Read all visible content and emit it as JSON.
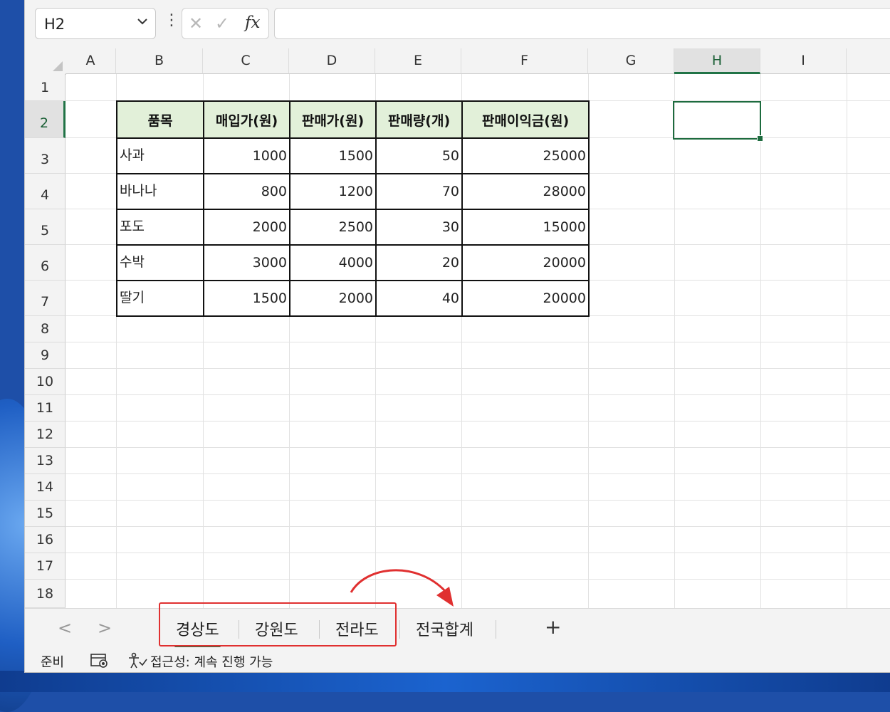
{
  "formula_bar": {
    "name_box": "H2",
    "more": "⋮",
    "cancel": "✕",
    "enter": "✓",
    "fx": "fx",
    "formula": ""
  },
  "columns": [
    "A",
    "B",
    "C",
    "D",
    "E",
    "F",
    "G",
    "H",
    "I"
  ],
  "selected_column": "H",
  "rows": [
    "1",
    "2",
    "3",
    "4",
    "5",
    "6",
    "7",
    "8",
    "9",
    "10",
    "11",
    "12",
    "13",
    "14",
    "15",
    "16",
    "17",
    "18"
  ],
  "selected_row": "2",
  "table": {
    "headers": [
      "품목",
      "매입가(원)",
      "판매가(원)",
      "판매량(개)",
      "판매이익금(원)"
    ],
    "rows": [
      [
        "사과",
        "1000",
        "1500",
        "50",
        "25000"
      ],
      [
        "바나나",
        "800",
        "1200",
        "70",
        "28000"
      ],
      [
        "포도",
        "2000",
        "2500",
        "30",
        "15000"
      ],
      [
        "수박",
        "3000",
        "4000",
        "20",
        "20000"
      ],
      [
        "딸기",
        "1500",
        "2000",
        "40",
        "20000"
      ]
    ]
  },
  "sheet_tabs": {
    "prev": "<",
    "next": ">",
    "tabs": [
      "경상도",
      "강원도",
      "전라도",
      "전국합계"
    ],
    "active": "경상도",
    "add": "+"
  },
  "annotation_color": "#e03030",
  "status_bar": {
    "ready": "준비",
    "accessibility": "접근성: 계속 진행 가능"
  },
  "colors": {
    "accent": "#217346",
    "header_fill": "#e2f0d9"
  }
}
